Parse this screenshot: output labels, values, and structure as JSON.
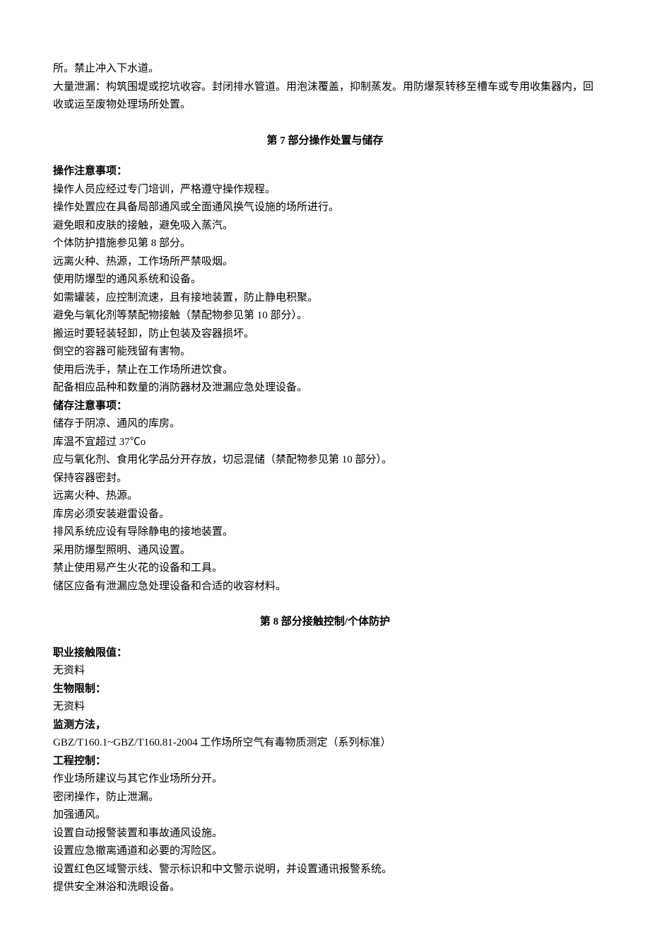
{
  "intro": {
    "line1": "所。禁止冲入下水道。",
    "line2": "大量泄漏：构筑围堤或挖坑收容。封闭排水管道。用泡沫覆盖，抑制蒸发。用防爆泵转移至槽车或专用收集器内，回收或运至废物处理场所处置。"
  },
  "section7": {
    "title": "第 7 部分操作处置与储存",
    "ops_label": "操作注意事项：",
    "ops_lines": [
      "操作人员应经过专门培训，严格遵守操作规程。",
      "操作处置应在具备局部通风或全面通风换气设施的场所进行。",
      "避免眼和皮肤的接触，避免吸入蒸汽。",
      "个体防护措施参见第 8 部分。",
      "远离火种、热源，工作场所严禁吸烟。",
      "使用防爆型的通风系统和设备。",
      "如需罐装，应控制流速，且有接地装置，防止静电积聚。",
      "避免与氧化剂等禁配物接触（禁配物参见第 10 部分）。",
      "搬运时要轻装轻卸，防止包装及容器损坏。",
      "倒空的容器可能残留有害物。",
      "使用后洗手，禁止在工作场所进饮食。",
      "配备相应品种和数量的消防器材及泄漏应急处理设备。"
    ],
    "storage_label": "储存注意事项：",
    "storage_lines": [
      "储存于阴凉、通风的库房。",
      "库温不宜超过 37℃o",
      "应与氧化剂、食用化学品分开存放，切忌混储（禁配物参见第 10 部分）。",
      "保持容器密封。",
      "远离火种、热源。",
      "库房必须安装避雷设备。",
      "排风系统应设有导除静电的接地装置。",
      "采用防爆型照明、通风设置。",
      "禁止使用易产生火花的设备和工具。",
      "储区应备有泄漏应急处理设备和合适的收容材料。"
    ]
  },
  "section8": {
    "title": "第 8 部分接触控制/个体防护",
    "exposure_label": "职业接触限值：",
    "exposure_val": "无资料",
    "bio_label": "生物限制：",
    "bio_val": "无资料",
    "monitor_label": "监测方法，",
    "monitor_val": "GBZ/T160.1~GBZ/T160.81-2004 工作场所空气有毒物质测定（系列标准）",
    "eng_label": "工程控制：",
    "eng_lines": [
      "作业场所建议与其它作业场所分开。",
      "密闭操作，防止泄漏。",
      "加强通风。",
      "设置自动报警装置和事故通风设施。",
      "设置应急撤离通道和必要的泻险区。",
      "设置红色区域警示线、警示标识和中文警示说明，并设置通讯报警系统。",
      "提供安全淋浴和洗眼设备。"
    ]
  }
}
